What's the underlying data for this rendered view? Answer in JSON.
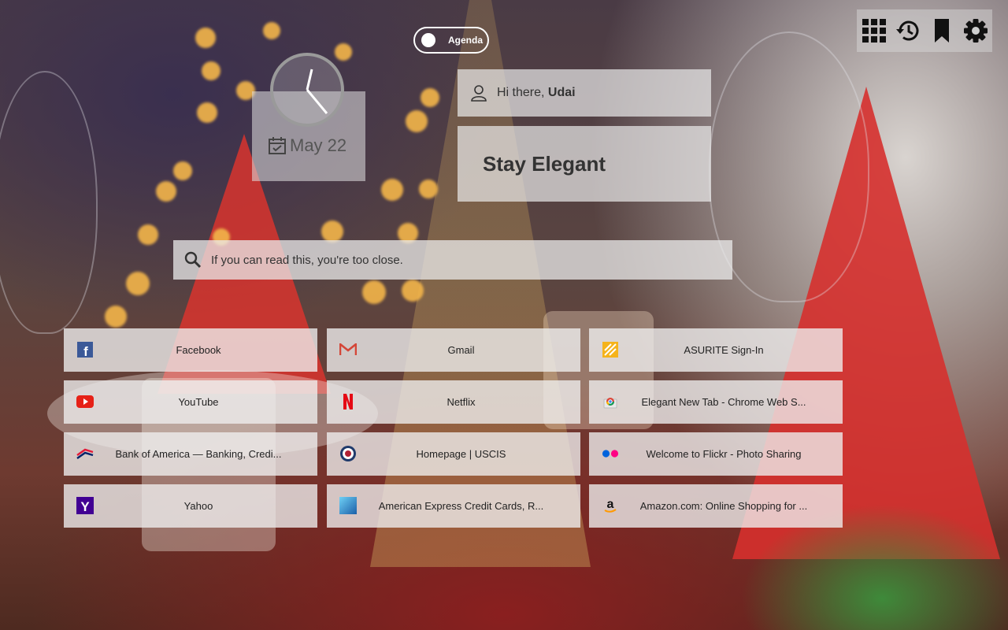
{
  "toolbar": {
    "icons": [
      "apps-grid-icon",
      "history-icon",
      "bookmark-icon",
      "settings-gear-icon"
    ]
  },
  "agenda": {
    "label": "Agenda"
  },
  "clock": {
    "date": "May 22"
  },
  "greeting": {
    "prefix": "Hi there, ",
    "name": "Udai"
  },
  "motto": {
    "text": "Stay Elegant"
  },
  "search": {
    "placeholder": "If you can read this, you're too close."
  },
  "tiles": [
    {
      "label": "Facebook",
      "icon": "facebook-icon",
      "color": "#3b5998"
    },
    {
      "label": "Gmail",
      "icon": "gmail-icon",
      "color": "#d44638"
    },
    {
      "label": "ASURITE Sign-In",
      "icon": "asurite-icon",
      "color": "#f5b31b"
    },
    {
      "label": "YouTube",
      "icon": "youtube-icon",
      "color": "#e62117"
    },
    {
      "label": "Netflix",
      "icon": "netflix-icon",
      "color": "#e50914"
    },
    {
      "label": "Elegant New Tab - Chrome Web S...",
      "icon": "chrome-web-store-icon",
      "color": "#4285f4"
    },
    {
      "label": "Bank of America — Banking, Credi...",
      "icon": "bank-of-america-icon",
      "color": "#012169"
    },
    {
      "label": "Homepage | USCIS",
      "icon": "uscis-seal-icon",
      "color": "#1f3a6b"
    },
    {
      "label": "Welcome to Flickr - Photo Sharing",
      "icon": "flickr-icon",
      "color": "#0063dc"
    },
    {
      "label": "Yahoo",
      "icon": "yahoo-icon",
      "color": "#410093"
    },
    {
      "label": "American Express Credit Cards, R...",
      "icon": "american-express-icon",
      "color": "#2e77bb"
    },
    {
      "label": "Amazon.com: Online Shopping for ...",
      "icon": "amazon-icon",
      "color": "#ff9900"
    }
  ]
}
